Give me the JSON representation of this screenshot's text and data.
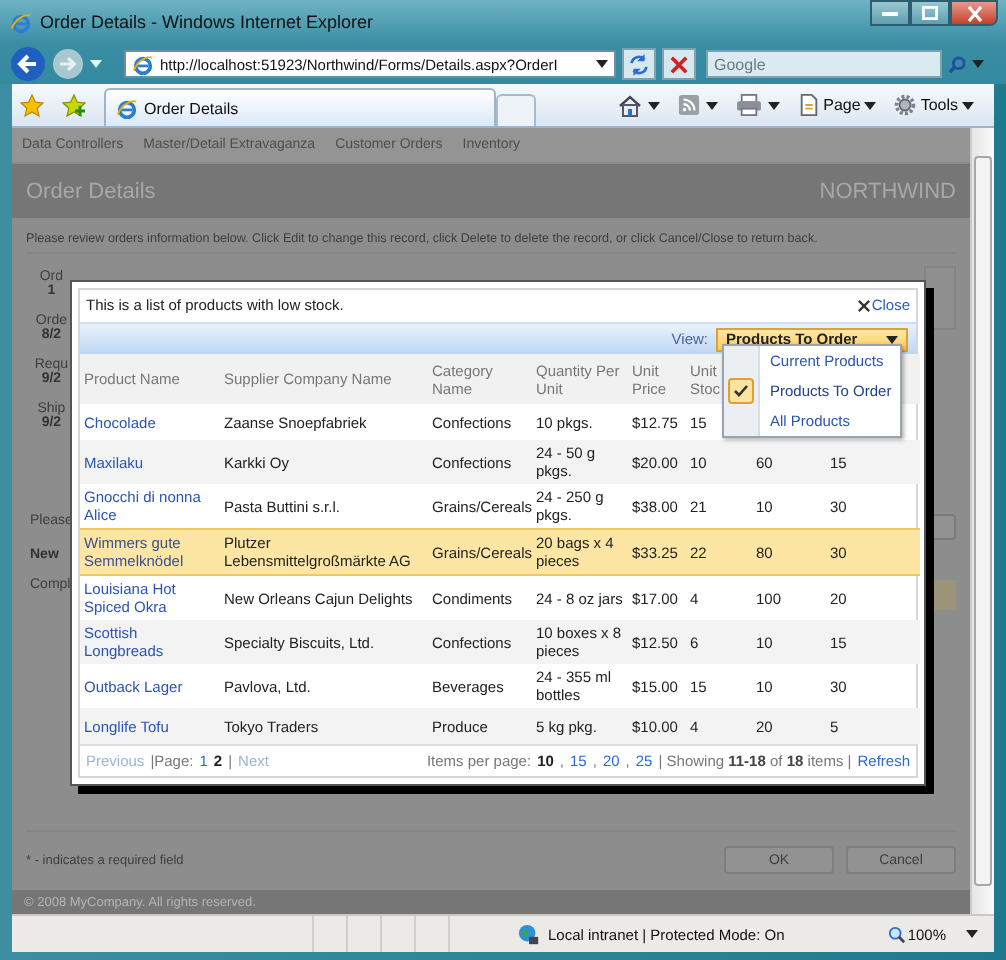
{
  "window": {
    "title": "Order Details - Windows Internet Explorer"
  },
  "address_bar": {
    "url": "http://localhost:51923/Northwind/Forms/Details.aspx?OrderI"
  },
  "search": {
    "placeholder": "Google"
  },
  "tabs": [
    {
      "label": "Order Details",
      "selected": true
    }
  ],
  "commands": [
    {
      "kind": "page",
      "label": "Page"
    },
    {
      "kind": "tools",
      "label": "Tools"
    }
  ],
  "page": {
    "nav": [
      "Data Controllers",
      "Master/Detail Extravaganza",
      "Customer Orders",
      "Inventory"
    ],
    "title": "Order Details",
    "brand": "NORTHWIND",
    "instructions": "Please review orders information below. Click Edit to change this record, click Delete to delete the record, or click Cancel/Close to return back.",
    "fields": [
      {
        "label": "Ord",
        "value": "1"
      },
      {
        "label": "Orde",
        "value": "8/2"
      },
      {
        "label": "Requ",
        "value": "9/2"
      },
      {
        "label": "Ship",
        "value": "9/2"
      }
    ],
    "section_texts": [
      {
        "kind": "prompt",
        "text": "Please"
      },
      {
        "kind": "heading",
        "text": "New"
      },
      {
        "kind": "prompt",
        "text": "Compl"
      }
    ],
    "note": "* - indicates a required field",
    "buttons": [
      "OK",
      "Cancel"
    ],
    "footer": "© 2008 MyCompany. All rights reserved."
  },
  "dialog": {
    "description": "This is a list of products with low stock.",
    "close": "Close",
    "view_label": "View:",
    "view_value": "Products To Order",
    "view_menu": {
      "expanded": true,
      "options": [
        {
          "label": "Current Products",
          "selected": false
        },
        {
          "label": "Products To Order",
          "selected": true
        },
        {
          "label": "All Products",
          "selected": false
        }
      ]
    },
    "columns": [
      {
        "label": "Product Name"
      },
      {
        "label": "Supplier Company Name"
      },
      {
        "label": "Category Name"
      },
      {
        "label": "Quantity Per Unit"
      },
      {
        "label": "Unit Price"
      },
      {
        "label": "Unit Stoc"
      }
    ],
    "rows": [
      {
        "selected": false,
        "cells": [
          "Chocolade",
          "Zaanse Snoepfabriek",
          "Confections",
          "10 pkgs.",
          "$12.75",
          "15"
        ]
      },
      {
        "selected": false,
        "cells": [
          "Maxilaku",
          "Karkki Oy",
          "Confections",
          "24 - 50 g pkgs.",
          "$20.00",
          "10",
          "60",
          "15"
        ]
      },
      {
        "selected": false,
        "cells": [
          "Gnocchi di nonna Alice",
          "Pasta Buttini s.r.l.",
          "Grains/Cereals",
          "24 - 250 g pkgs.",
          "$38.00",
          "21",
          "10",
          "30"
        ]
      },
      {
        "selected": true,
        "cells": [
          "Wimmers gute Semmelknödel",
          "Plutzer Lebensmittelgroßmärkte AG",
          "Grains/Cereals",
          "20 bags x 4 pieces",
          "$33.25",
          "22",
          "80",
          "30"
        ]
      },
      {
        "selected": false,
        "cells": [
          "Louisiana Hot Spiced Okra",
          "New Orleans Cajun Delights",
          "Condiments",
          "24 - 8 oz jars",
          "$17.00",
          "4",
          "100",
          "20"
        ]
      },
      {
        "selected": false,
        "cells": [
          "Scottish Longbreads",
          "Specialty Biscuits, Ltd.",
          "Confections",
          "10 boxes x 8 pieces",
          "$12.50",
          "6",
          "10",
          "15"
        ]
      },
      {
        "selected": false,
        "cells": [
          "Outback Lager",
          "Pavlova, Ltd.",
          "Beverages",
          "24 - 355 ml bottles",
          "$15.00",
          "15",
          "10",
          "30"
        ]
      },
      {
        "selected": false,
        "cells": [
          "Longlife Tofu",
          "Tokyo Traders",
          "Produce",
          "5 kg pkg.",
          "$10.00",
          "4",
          "20",
          "5"
        ]
      }
    ],
    "pager_left": [
      {
        "kind": "link",
        "label": "Previous",
        "disabled": true,
        "selected": false
      },
      {
        "kind": "text",
        "label": "|Page:"
      },
      {
        "kind": "link",
        "label": "1",
        "disabled": false,
        "selected": false
      },
      {
        "kind": "link",
        "label": "2",
        "disabled": false,
        "selected": true
      },
      {
        "kind": "text",
        "label": "|"
      },
      {
        "kind": "link",
        "label": "Next",
        "disabled": true,
        "selected": false
      }
    ],
    "pager_right": [
      {
        "kind": "text",
        "label": "Items per page:"
      },
      {
        "kind": "link",
        "label": "10",
        "disabled": false,
        "selected": true
      },
      {
        "kind": "text",
        "label": ","
      },
      {
        "kind": "link",
        "label": "15",
        "disabled": false,
        "selected": false
      },
      {
        "kind": "text",
        "label": ","
      },
      {
        "kind": "link",
        "label": "20",
        "disabled": false,
        "selected": false
      },
      {
        "kind": "text",
        "label": ","
      },
      {
        "kind": "link",
        "label": "25",
        "disabled": false,
        "selected": false
      },
      {
        "kind": "text",
        "label": "| Showing **11-18** of **18** items |"
      },
      {
        "kind": "link",
        "label": "Refresh",
        "disabled": false,
        "selected": false
      }
    ]
  },
  "status_bar": {
    "zone": "Local intranet | Protected Mode: On",
    "zoom": "100%"
  }
}
